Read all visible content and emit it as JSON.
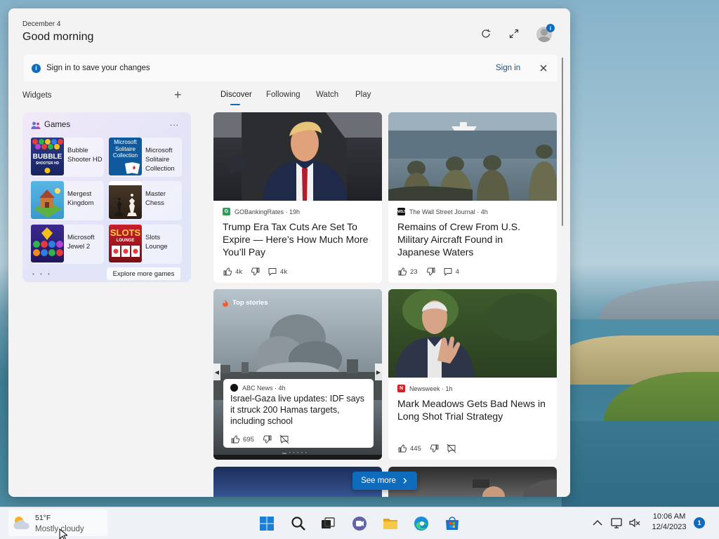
{
  "colors": {
    "accent": "#0f6cbd",
    "panel_bg": "#f3f3f3"
  },
  "header": {
    "date": "December 4",
    "greeting": "Good morning",
    "avatar_badge": "i",
    "icons": [
      "refresh-icon",
      "expand-icon",
      "profile-avatar"
    ]
  },
  "signin_bar": {
    "info_icon": "i",
    "message": "Sign in to save your changes",
    "link": "Sign in",
    "close_icon": "close-icon"
  },
  "widgets": {
    "label": "Widgets",
    "add_icon": "+",
    "games": {
      "title": "Games",
      "more_icon": "...",
      "items": [
        {
          "name": "Bubble Shooter HD",
          "thumb_text": "BUBBLE",
          "thumb_sub": "SHOOTER HD"
        },
        {
          "name": "Microsoft Solitaire Collection",
          "thumb_text": "Microsoft Solitaire Collection"
        },
        {
          "name": "Mergest Kingdom"
        },
        {
          "name": "Master Chess"
        },
        {
          "name": "Microsoft Jewel 2"
        },
        {
          "name": "Slots Lounge",
          "thumb_text": "SLOTS",
          "thumb_sub": "LOUNGE"
        }
      ],
      "pager_dots": "• • •",
      "explore": "Explore more games"
    }
  },
  "feed": {
    "tabs": [
      "Discover",
      "Following",
      "Watch",
      "Play"
    ],
    "active_tab": "Discover",
    "cards": [
      {
        "source": "GOBankingRates · 19h",
        "title": "Trump Era Tax Cuts Are Set To Expire — Here’s How Much More You’ll Pay",
        "likes": "4k",
        "comments": "4k"
      },
      {
        "source": "The Wall Street Journal · 4h",
        "source_logo": "WSJ",
        "title": "Remains of Crew From U.S. Military Aircraft Found in Japanese Waters",
        "likes": "23",
        "comments": "4"
      },
      {
        "source": "Newsweek · 1h",
        "source_logo": "N",
        "title": "Mark Meadows Gets Bad News in Long Shot Trial Strategy",
        "likes": "445"
      }
    ],
    "hero": {
      "label": "Top stories",
      "source": "ABC News · 4h",
      "title": "Israel-Gaza live updates: IDF says it struck 200 Hamas targets, including school",
      "likes": "695",
      "pager": "▬ • • • • •"
    },
    "see_more": "See more"
  },
  "taskbar": {
    "weather_temp": "51°F",
    "weather_cond": "Mostly cloudy",
    "apps": [
      "start-icon",
      "search-icon",
      "task-view-icon",
      "teams-chat-icon",
      "file-explorer-icon",
      "edge-icon",
      "store-icon"
    ],
    "clock_time": "10:06 AM",
    "clock_date": "12/4/2023",
    "notifications": "1"
  }
}
